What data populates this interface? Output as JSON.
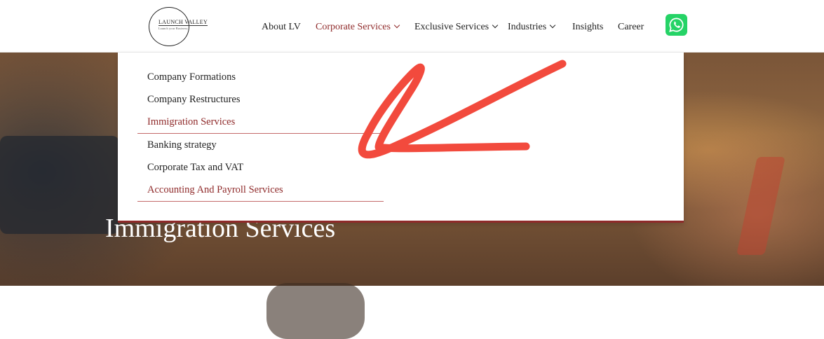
{
  "logo": {
    "name": "LAUNCH VALLEY",
    "tagline": "Launch your Business"
  },
  "nav": {
    "items": [
      {
        "label": "About LV",
        "dropdown": false,
        "active": false
      },
      {
        "label": "Corporate Services",
        "dropdown": true,
        "active": true
      },
      {
        "label": "Exclusive Services",
        "dropdown": true,
        "active": false
      },
      {
        "label": "Industries",
        "dropdown": true,
        "active": false
      },
      {
        "label": "Insights",
        "dropdown": false,
        "active": false
      },
      {
        "label": "Career",
        "dropdown": false,
        "active": false
      }
    ],
    "whatsapp_icon": "whatsapp-icon"
  },
  "dropdown": {
    "items": [
      {
        "label": "Company Formations",
        "highlight": false
      },
      {
        "label": "Company Restructures",
        "highlight": false
      },
      {
        "label": "Immigration Services",
        "highlight": true
      },
      {
        "label": "Banking strategy",
        "highlight": false
      },
      {
        "label": "Corporate Tax and VAT",
        "highlight": false
      },
      {
        "label": "Accounting And Payroll Services",
        "highlight": true
      }
    ]
  },
  "hero": {
    "title": "Immigration Services"
  },
  "colors": {
    "accent": "#8f2a2a",
    "whatsapp": "#25d366",
    "annotation": "#f24a3d"
  }
}
